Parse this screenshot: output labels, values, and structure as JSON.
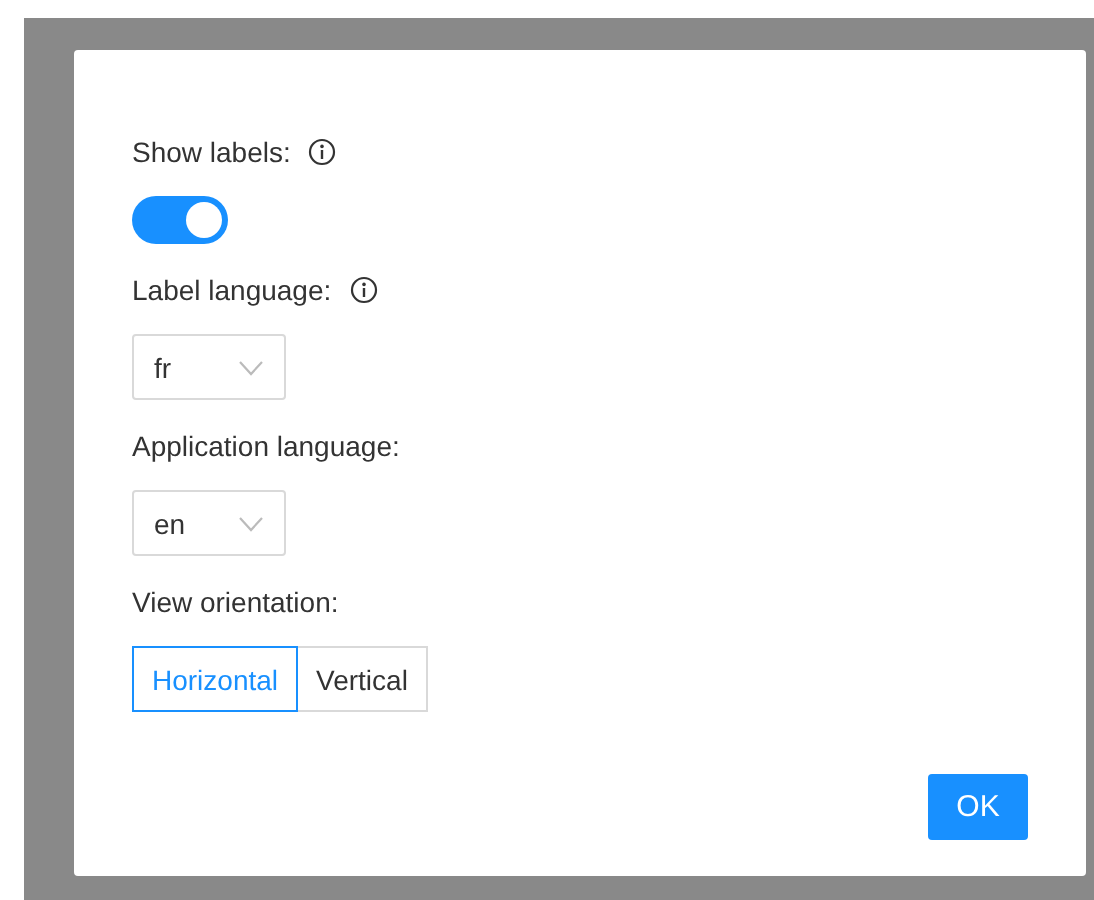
{
  "settings": [
    {
      "kind": "toggle",
      "label": "Show labels:",
      "info": true,
      "on": true
    },
    {
      "kind": "select",
      "label": "Label language:",
      "info": true,
      "value": "fr"
    },
    {
      "kind": "select",
      "label": "Application language:",
      "info": false,
      "value": "en"
    },
    {
      "kind": "segmented",
      "label": "View orientation:",
      "info": false,
      "options": [
        {
          "label": "Horizontal",
          "selected": true
        },
        {
          "label": "Vertical",
          "selected": false
        }
      ]
    }
  ],
  "buttons": [
    {
      "label": "OK"
    }
  ]
}
